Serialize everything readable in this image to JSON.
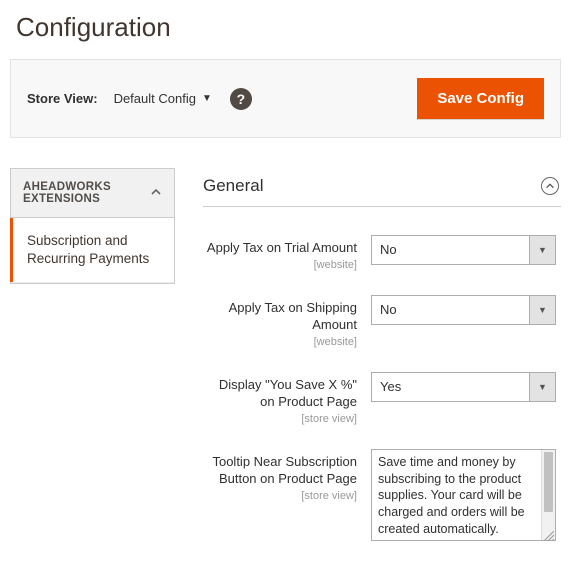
{
  "page_title": "Configuration",
  "toolbar": {
    "store_view_label": "Store View:",
    "store_view_value": "Default Config",
    "save_label": "Save Config"
  },
  "sidebar": {
    "group_label": "AHEADWORKS EXTENSIONS",
    "items": [
      {
        "label": "Subscription and Recurring Payments"
      }
    ]
  },
  "section": {
    "title": "General",
    "fields": [
      {
        "label": "Apply Tax on Trial Amount",
        "scope": "[website]",
        "value": "No",
        "type": "select"
      },
      {
        "label": "Apply Tax on Shipping Amount",
        "scope": "[website]",
        "value": "No",
        "type": "select"
      },
      {
        "label": "Display \"You Save X %\" on Product Page",
        "scope": "[store view]",
        "value": "Yes",
        "type": "select"
      },
      {
        "label": "Tooltip Near Subscription Button on Product Page",
        "scope": "[store view]",
        "value": "Save time and money by subscribing to the product supplies.\nYour card will be charged and orders will be created automatically.",
        "type": "textarea"
      }
    ]
  }
}
